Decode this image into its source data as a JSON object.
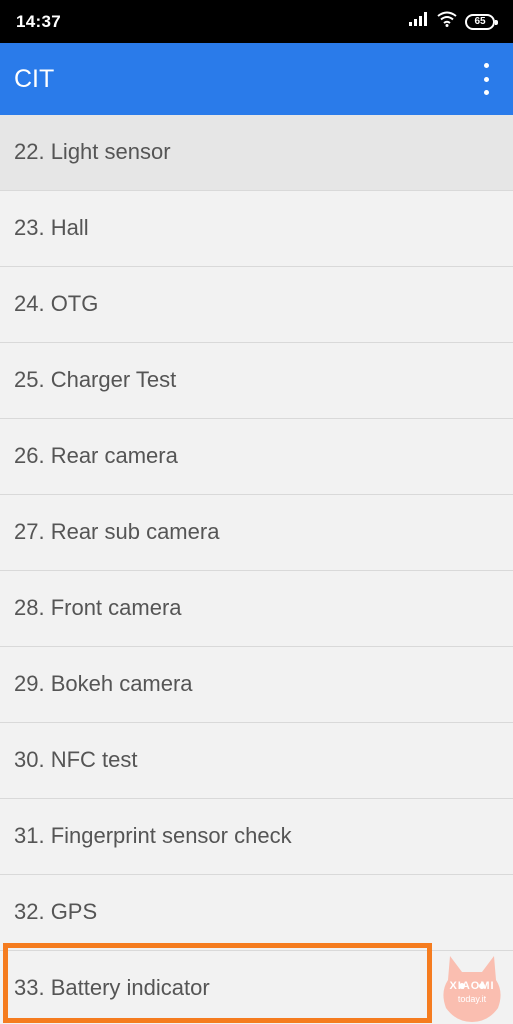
{
  "status_bar": {
    "time": "14:37",
    "battery_level": "65",
    "icons": [
      "signal-icon",
      "wifi-icon",
      "battery-icon"
    ]
  },
  "app_bar": {
    "title": "CIT",
    "menu_icon": "more-vert-icon"
  },
  "list": {
    "items": [
      {
        "label": "22. Light sensor"
      },
      {
        "label": "23. Hall"
      },
      {
        "label": "24. OTG"
      },
      {
        "label": "25. Charger Test"
      },
      {
        "label": "26. Rear camera"
      },
      {
        "label": "27. Rear sub camera"
      },
      {
        "label": "28. Front camera"
      },
      {
        "label": "29. Bokeh camera"
      },
      {
        "label": "30. NFC test"
      },
      {
        "label": "31. Fingerprint sensor check"
      },
      {
        "label": "32. GPS"
      },
      {
        "label": "33. Battery indicator"
      }
    ],
    "highlighted_item": "33. Battery indicator"
  },
  "watermark": {
    "brand": "XIAOMI",
    "site": "today.it"
  },
  "colors": {
    "status_bar": "#000000",
    "app_bar": "#2a7bea",
    "highlight": "#f57c1f",
    "watermark": "#fbb8a8"
  }
}
